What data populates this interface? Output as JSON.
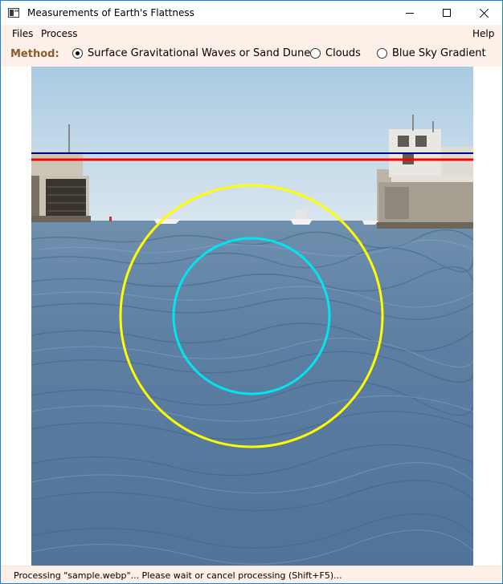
{
  "window": {
    "title": "Measurements of Earth's Flattness"
  },
  "menu": {
    "files": "Files",
    "process": "Process",
    "help": "Help"
  },
  "method": {
    "label": "Method:",
    "options": [
      {
        "label": "Surface Gravitational Waves or Sand Dunes",
        "selected": true
      },
      {
        "label": "Clouds",
        "selected": false
      },
      {
        "label": "Blue Sky Gradient",
        "selected": false
      }
    ]
  },
  "overlay": {
    "horizon_line_colors": [
      "#00008b",
      "#ff0000"
    ],
    "outer_circle_color": "#ffff00",
    "inner_circle_color": "#00e5ee"
  },
  "status": {
    "text": "Processing \"sample.webp\"... Please wait or cancel processing (Shift+F5)..."
  }
}
